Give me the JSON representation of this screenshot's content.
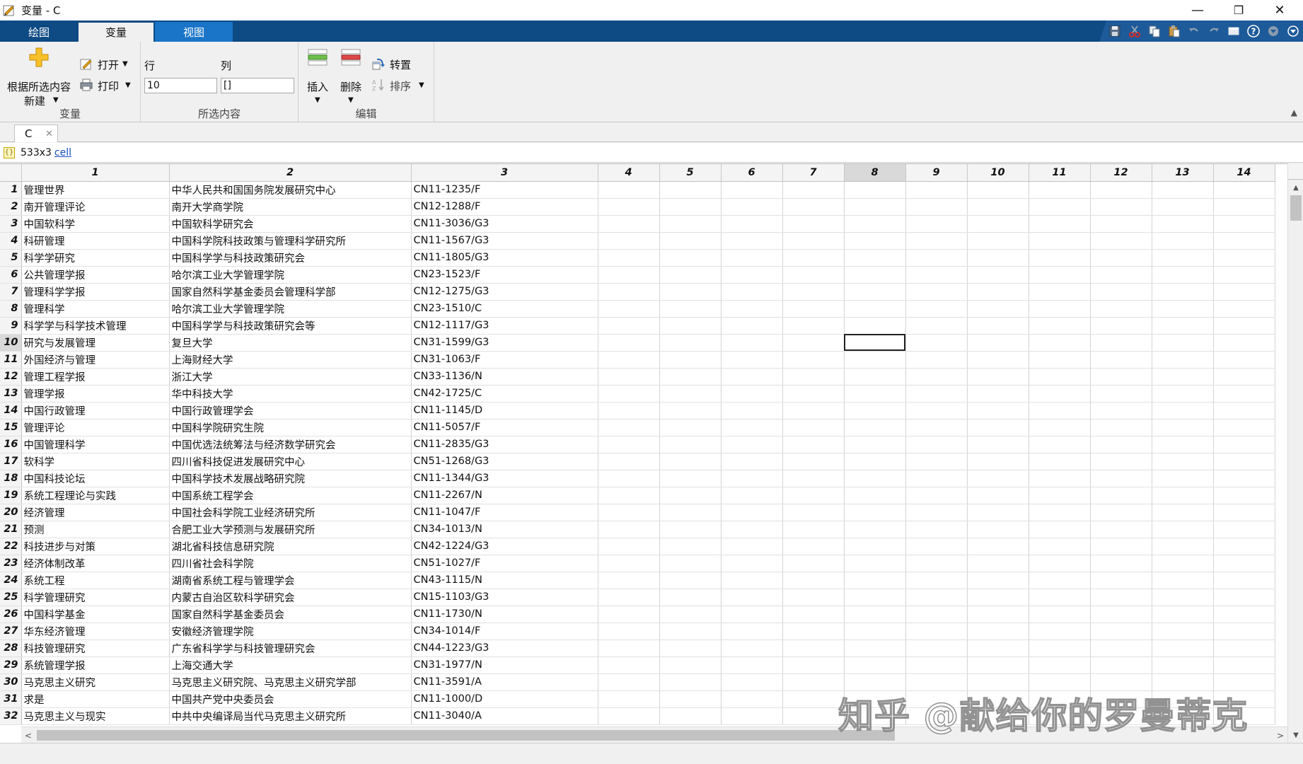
{
  "window": {
    "title": "变量 - C",
    "controls": {
      "minimize": "—",
      "maximize": "❐",
      "close": "✕"
    }
  },
  "ribbon": {
    "tabs": [
      {
        "label": "绘图",
        "state": "inactive"
      },
      {
        "label": "变量",
        "state": "active"
      },
      {
        "label": "视图",
        "state": "highlighted"
      }
    ],
    "quick_access": [
      "save-icon",
      "cut-icon",
      "copy-icon",
      "paste-icon",
      "undo-icon",
      "redo-icon",
      "switch-windows-icon",
      "help-icon",
      "options-icon",
      "expand-icon"
    ]
  },
  "toolstrip": {
    "variable": {
      "new_from_selection": "根据所选内容",
      "new": "新建",
      "open": "打开",
      "print": "打印",
      "section_label": "变量"
    },
    "selection": {
      "row_label": "行",
      "col_label": "列",
      "row_value": "10",
      "col_value": "[]",
      "section_label": "所选内容"
    },
    "edit": {
      "insert": "插入",
      "delete": "删除",
      "transpose": "转置",
      "sort": "排序",
      "section_label": "编辑"
    }
  },
  "document_tab": {
    "label": "C",
    "close": "✕"
  },
  "info": {
    "size": "533x3",
    "class_link": "cell"
  },
  "grid": {
    "column_headers": [
      "1",
      "2",
      "3",
      "4",
      "5",
      "6",
      "7",
      "8",
      "9",
      "10",
      "11",
      "12",
      "13",
      "14"
    ],
    "selected_column": "8",
    "selected_row": "10",
    "rows": [
      {
        "n": "1",
        "c1": "管理世界",
        "c2": "中华人民共和国国务院发展研究中心",
        "c3": "CN11-1235/F"
      },
      {
        "n": "2",
        "c1": "南开管理评论",
        "c2": "南开大学商学院",
        "c3": "CN12-1288/F"
      },
      {
        "n": "3",
        "c1": "中国软科学",
        "c2": "中国软科学研究会",
        "c3": "CN11-3036/G3"
      },
      {
        "n": "4",
        "c1": "科研管理",
        "c2": "中国科学院科技政策与管理科学研究所",
        "c3": "CN11-1567/G3"
      },
      {
        "n": "5",
        "c1": "科学学研究",
        "c2": "中国科学学与科技政策研究会",
        "c3": "CN11-1805/G3"
      },
      {
        "n": "6",
        "c1": "公共管理学报",
        "c2": "哈尔滨工业大学管理学院",
        "c3": "CN23-1523/F"
      },
      {
        "n": "7",
        "c1": "管理科学学报",
        "c2": "国家自然科学基金委员会管理科学部",
        "c3": "CN12-1275/G3"
      },
      {
        "n": "8",
        "c1": "管理科学",
        "c2": "哈尔滨工业大学管理学院",
        "c3": "CN23-1510/C"
      },
      {
        "n": "9",
        "c1": "科学学与科学技术管理",
        "c2": "中国科学学与科技政策研究会等",
        "c3": "CN12-1117/G3"
      },
      {
        "n": "10",
        "c1": "研究与发展管理",
        "c2": "复旦大学",
        "c3": "CN31-1599/G3"
      },
      {
        "n": "11",
        "c1": "外国经济与管理",
        "c2": "上海财经大学",
        "c3": "CN31-1063/F"
      },
      {
        "n": "12",
        "c1": "管理工程学报",
        "c2": "浙江大学",
        "c3": "CN33-1136/N"
      },
      {
        "n": "13",
        "c1": "管理学报",
        "c2": "华中科技大学",
        "c3": "CN42-1725/C"
      },
      {
        "n": "14",
        "c1": "中国行政管理",
        "c2": "中国行政管理学会",
        "c3": "CN11-1145/D"
      },
      {
        "n": "15",
        "c1": "管理评论",
        "c2": "中国科学院研究生院",
        "c3": "CN11-5057/F"
      },
      {
        "n": "16",
        "c1": "中国管理科学",
        "c2": "中国优选法统筹法与经济数学研究会",
        "c3": "CN11-2835/G3"
      },
      {
        "n": "17",
        "c1": "软科学",
        "c2": "四川省科技促进发展研究中心",
        "c3": "CN51-1268/G3"
      },
      {
        "n": "18",
        "c1": "中国科技论坛",
        "c2": "中国科学技术发展战略研究院",
        "c3": "CN11-1344/G3"
      },
      {
        "n": "19",
        "c1": "系统工程理论与实践",
        "c2": "中国系统工程学会",
        "c3": "CN11-2267/N"
      },
      {
        "n": "20",
        "c1": "经济管理",
        "c2": "中国社会科学院工业经济研究所",
        "c3": "CN11-1047/F"
      },
      {
        "n": "21",
        "c1": "预测",
        "c2": "合肥工业大学预测与发展研究所",
        "c3": "CN34-1013/N"
      },
      {
        "n": "22",
        "c1": "科技进步与对策",
        "c2": "湖北省科技信息研究院",
        "c3": "CN42-1224/G3"
      },
      {
        "n": "23",
        "c1": "经济体制改革",
        "c2": "四川省社会科学院",
        "c3": "CN51-1027/F"
      },
      {
        "n": "24",
        "c1": "系统工程",
        "c2": "湖南省系统工程与管理学会",
        "c3": "CN43-1115/N"
      },
      {
        "n": "25",
        "c1": "科学管理研究",
        "c2": "内蒙古自治区软科学研究会",
        "c3": "CN15-1103/G3"
      },
      {
        "n": "26",
        "c1": "中国科学基金",
        "c2": "国家自然科学基金委员会",
        "c3": "CN11-1730/N"
      },
      {
        "n": "27",
        "c1": "华东经济管理",
        "c2": "安徽经济管理学院",
        "c3": "CN34-1014/F"
      },
      {
        "n": "28",
        "c1": "科技管理研究",
        "c2": "广东省科学学与科技管理研究会",
        "c3": "CN44-1223/G3"
      },
      {
        "n": "29",
        "c1": "系统管理学报",
        "c2": "上海交通大学",
        "c3": "CN31-1977/N"
      },
      {
        "n": "30",
        "c1": "马克思主义研究",
        "c2": "马克思主义研究院、马克思主义研究学部",
        "c3": "CN11-3591/A"
      },
      {
        "n": "31",
        "c1": "求是",
        "c2": "中国共产党中央委员会",
        "c3": "CN11-1000/D"
      },
      {
        "n": "32",
        "c1": "马克思主义与现实",
        "c2": "中共中央编译局当代马克思主义研究所",
        "c3": "CN11-3040/A"
      }
    ]
  },
  "watermark": "知乎 @献给你的罗曼蒂克",
  "colors": {
    "ribbon_blue": "#0e4a83",
    "tab_highlight": "#1a74c8",
    "link": "#1a4cc2"
  }
}
